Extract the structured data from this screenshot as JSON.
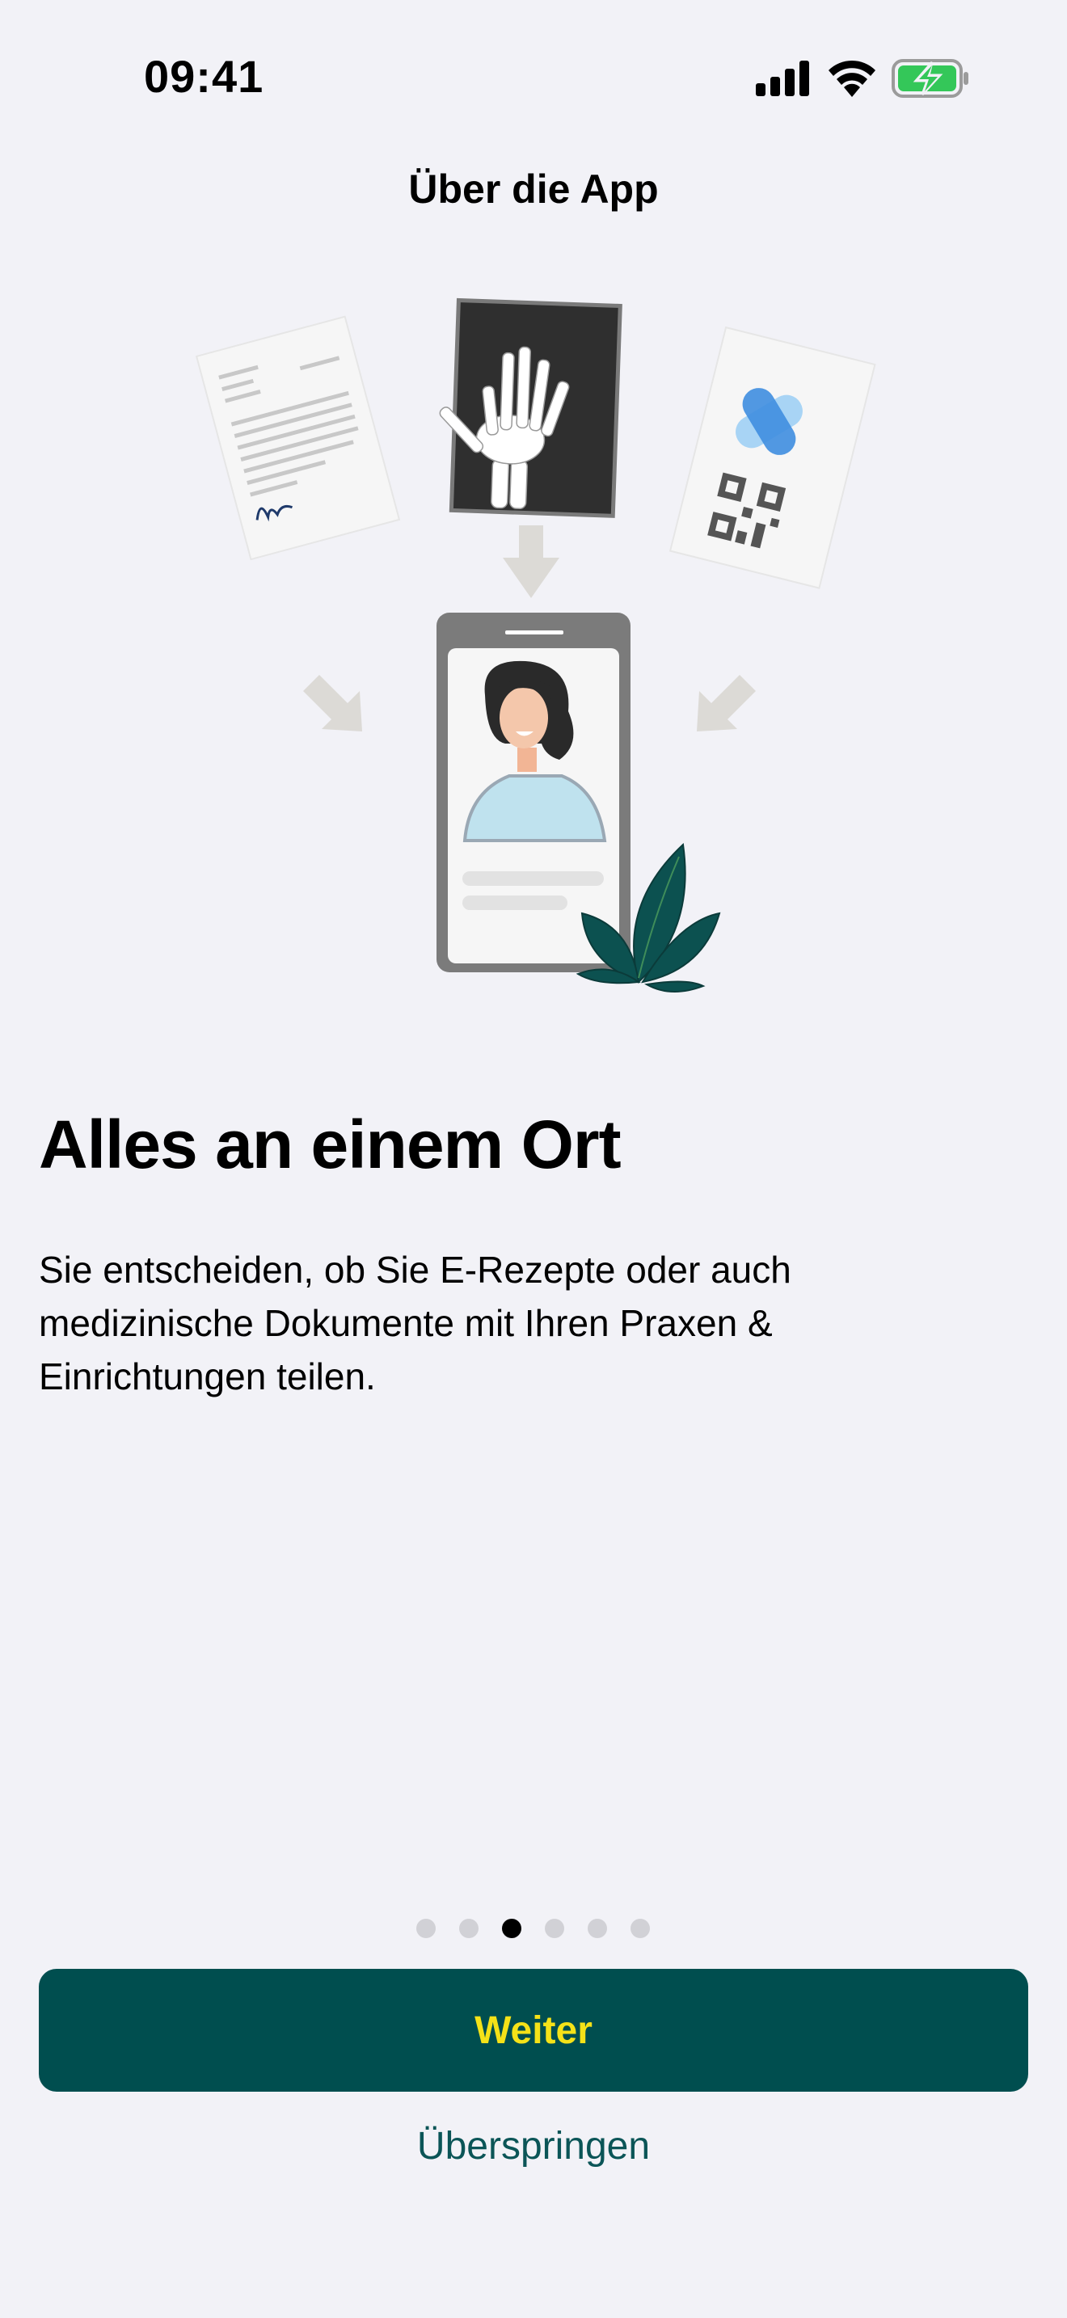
{
  "status_bar": {
    "time": "09:41",
    "icons": [
      "signal-icon",
      "wifi-icon",
      "battery-charging-icon"
    ]
  },
  "nav": {
    "title": "Über die App"
  },
  "illustration": {
    "name": "documents-to-phone-illustration",
    "elements": [
      "letter-document",
      "xray-hand",
      "prescription-qr-document",
      "phone-profile",
      "plant"
    ]
  },
  "content": {
    "headline": "Alles an einem Ort",
    "body": "Sie entscheiden, ob Sie E-Rezepte oder auch medizinische Dokumente mit Ihren Praxen & Einrichtungen teilen."
  },
  "pagination": {
    "total": 6,
    "current": 3
  },
  "actions": {
    "primary_label": "Weiter",
    "secondary_label": "Überspringen"
  },
  "colors": {
    "background": "#f2f2f7",
    "primary_button": "#004e4f",
    "primary_button_text": "#f5e218",
    "link": "#0b5557",
    "dot_inactive": "#d1d1d6",
    "dot_active": "#000000"
  }
}
